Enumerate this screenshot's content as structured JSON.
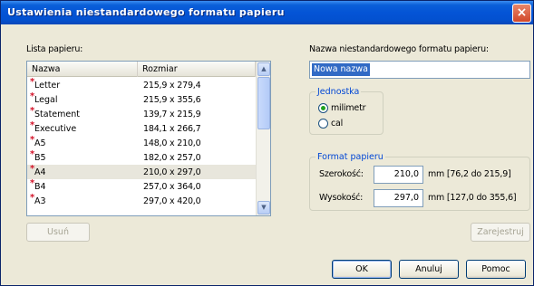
{
  "window": {
    "title": "Ustawienia niestandardowego formatu papieru",
    "close_label": "×"
  },
  "left": {
    "list_label": "Lista papieru:",
    "columns": {
      "name": "Nazwa",
      "size": "Rozmiar"
    },
    "rows": [
      {
        "name": "Letter",
        "size": "215,9 x 279,4",
        "selected": false
      },
      {
        "name": "Legal",
        "size": "215,9 x 355,6",
        "selected": false
      },
      {
        "name": "Statement",
        "size": "139,7 x 215,9",
        "selected": false
      },
      {
        "name": "Executive",
        "size": "184,1 x 266,7",
        "selected": false
      },
      {
        "name": "A5",
        "size": "148,0 x 210,0",
        "selected": false
      },
      {
        "name": "B5",
        "size": "182,0 x 257,0",
        "selected": false
      },
      {
        "name": "A4",
        "size": "210,0 x 297,0",
        "selected": true
      },
      {
        "name": "B4",
        "size": "257,0 x 364,0",
        "selected": false
      },
      {
        "name": "A3",
        "size": "297,0 x 420,0",
        "selected": false
      }
    ],
    "row_marker": "*",
    "delete_button": "Usuń"
  },
  "right": {
    "name_label": "Nazwa niestandardowego formatu papieru:",
    "name_value": "Nowa nazwa",
    "units": {
      "title": "Jednostka",
      "options": [
        "milimetr",
        "cal"
      ],
      "selected": "milimetr"
    },
    "format": {
      "title": "Format papieru",
      "width_label": "Szerokość:",
      "width_value": "210,0",
      "width_range": "mm [76,2 do 215,9]",
      "height_label": "Wysokość:",
      "height_value": "297,0",
      "height_range": "mm [127,0 do 355,6]"
    },
    "save_button": "Zarejestruj"
  },
  "footer": {
    "ok": "OK",
    "cancel": "Anuluj",
    "help": "Pomoc"
  },
  "colors": {
    "title_bar": "#0454d6",
    "group_title": "#0046d5",
    "selection": "#316ac5",
    "row_marker": "#d4142a"
  }
}
